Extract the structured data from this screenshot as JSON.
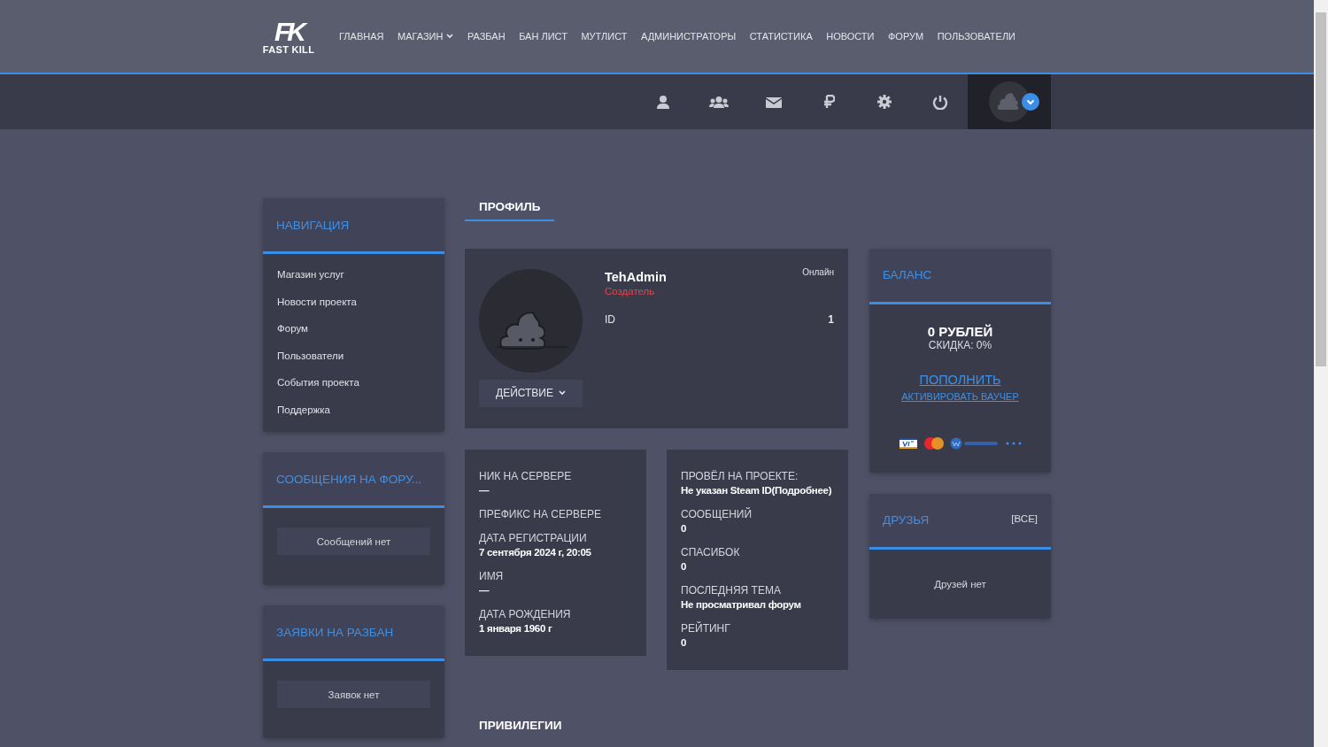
{
  "logo": {
    "mark": "FK",
    "text": "FAST KILL"
  },
  "nav": [
    {
      "label": "ГЛАВНАЯ",
      "kind": "link"
    },
    {
      "label": "МАГАЗИН",
      "kind": "dropdown"
    },
    {
      "label": "РАЗБАН",
      "kind": "link"
    },
    {
      "label": "БАН ЛИСТ",
      "kind": "link"
    },
    {
      "label": "МУТЛИСТ",
      "kind": "link"
    },
    {
      "label": "АДМИНИСТРАТОРЫ",
      "kind": "link"
    },
    {
      "label": "СТАТИСТИКА",
      "kind": "link"
    },
    {
      "label": "НОВОСТИ",
      "kind": "link"
    },
    {
      "label": "ФОРУМ",
      "kind": "link"
    },
    {
      "label": "ПОЛЬЗОВАТЕЛИ",
      "kind": "link"
    }
  ],
  "sidebar": [
    {
      "title": "НАВИГАЦИЯ",
      "kind": "list",
      "items": [
        "Магазин услуг",
        "Новости проекта",
        "Форум",
        "Пользователи",
        "События проекта",
        "Поддержка"
      ]
    },
    {
      "title": "СООБЩЕНИЯ НА ФОРУ...",
      "kind": "empty",
      "message": "Сообщений нет"
    },
    {
      "title": "ЗАЯВКИ НА РАЗБАН",
      "kind": "empty",
      "message": "Заявок нет"
    }
  ],
  "section_title": "ПРОФИЛЬ",
  "profile": {
    "name": "TehAdmin",
    "role": "Создатель",
    "status": "Онлайн",
    "id_label": "ID",
    "id_value": "1",
    "action_button": "ДЕЙСТВИЕ"
  },
  "details_left": [
    {
      "label": "НИК НА СЕРВЕРЕ",
      "value": "—"
    },
    {
      "label": "ПРЕФИКС НА СЕРВЕРЕ"
    },
    {
      "label": "ДАТА РЕГИСТРАЦИИ",
      "value": "7 сентября 2024 г, 20:05"
    },
    {
      "label": "ИМЯ",
      "value": "—"
    },
    {
      "label": "ДАТА РОЖДЕНИЯ",
      "value": "1 января 1960 г"
    }
  ],
  "details_right": [
    {
      "label": "ПРОВЁЛ НА ПРОЕКТЕ:",
      "value": "Не указан Steam ID(Подробнее)"
    },
    {
      "label": "СООБЩЕНИЙ",
      "value": "0"
    },
    {
      "label": "СПАСИБОК",
      "value": "0"
    },
    {
      "label": "ПОСЛЕДНЯЯ ТЕМА",
      "value": "Не просматривал форум"
    },
    {
      "label": "РЕЙТИНГ",
      "value": "0"
    }
  ],
  "balance": {
    "title": "БАЛАНС",
    "amount": "0 РУБЛЕЙ",
    "discount": "СКИДКА: 0%",
    "top_up_link": "ПОПОЛНИТЬ",
    "voucher_link": "АКТИВИРОВАТЬ ВАУЧЕР"
  },
  "friends": {
    "title": "ДРУЗЬЯ",
    "all_link": "[ВСЕ]",
    "message": "Друзей нет"
  },
  "privileges_title": "ПРИВИЛЕГИИ"
}
